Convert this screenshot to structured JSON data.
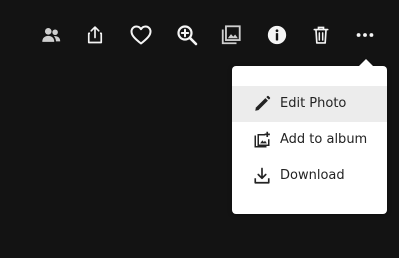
{
  "toolbar": {
    "buttons": [
      {
        "icon": "people-icon",
        "tooltip": ""
      },
      {
        "icon": "share-icon",
        "tooltip": ""
      },
      {
        "icon": "heart-icon",
        "tooltip": ""
      },
      {
        "icon": "zoom-in-icon",
        "tooltip": ""
      },
      {
        "icon": "photo-stack-icon",
        "tooltip": ""
      },
      {
        "icon": "info-icon",
        "tooltip": ""
      },
      {
        "icon": "trash-icon",
        "tooltip": ""
      },
      {
        "icon": "more-icon",
        "tooltip": ""
      }
    ],
    "icon_color": "#f5f5f5",
    "dim_icon_color": "#cfcfcf"
  },
  "menu": {
    "items": [
      {
        "label": "Edit Photo",
        "icon": "pencil-icon",
        "highlighted": true
      },
      {
        "label": "Add to album",
        "icon": "add-to-album-icon",
        "highlighted": false
      },
      {
        "label": "Download",
        "icon": "download-icon",
        "highlighted": false
      }
    ],
    "background": "#ffffff",
    "highlight_color": "#ececec",
    "text_color": "#232323"
  },
  "colors": {
    "page_background": "#131313"
  }
}
